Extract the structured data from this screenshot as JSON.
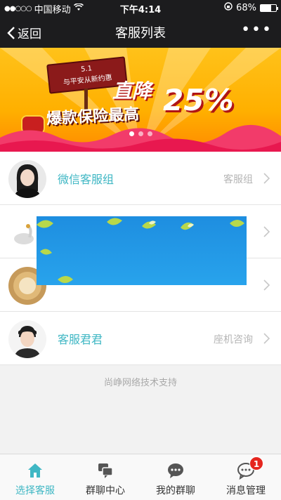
{
  "status_bar": {
    "carrier": "中国移动",
    "time": "下午4:14",
    "battery": "68%",
    "battery_level": 0.68
  },
  "nav": {
    "back_label": "返回",
    "title": "客服列表",
    "more_icon": "more-dots-icon"
  },
  "banner": {
    "sign_line1": "5.1",
    "sign_line2": "与平安从新约惠",
    "headline": "爆款保险最高",
    "drop_text": "直降",
    "percent": "25%",
    "slides": 3,
    "active_slide": 0
  },
  "list": {
    "items": [
      {
        "name": "微信客服组",
        "tag": "客服组",
        "avatar": "girl-avatar"
      },
      {
        "name": "",
        "tag": "",
        "avatar": "swan-avatar"
      },
      {
        "name": "",
        "tag": "",
        "avatar": "round-avatar"
      },
      {
        "name": "客服君君",
        "tag": "座机咨询",
        "avatar": "boy-avatar"
      }
    ]
  },
  "footer_note": "尚峥网络技术支持",
  "tabs": [
    {
      "label": "选择客服",
      "icon": "home-icon",
      "active": true
    },
    {
      "label": "群聊中心",
      "icon": "group-chat-icon",
      "active": false
    },
    {
      "label": "我的群聊",
      "icon": "my-chat-icon",
      "active": false
    },
    {
      "label": "消息管理",
      "icon": "message-icon",
      "active": false,
      "badge": "1"
    }
  ],
  "colors": {
    "accent": "#3fb7c4",
    "bar": "#1c1c1e",
    "badge": "#e5261f"
  }
}
